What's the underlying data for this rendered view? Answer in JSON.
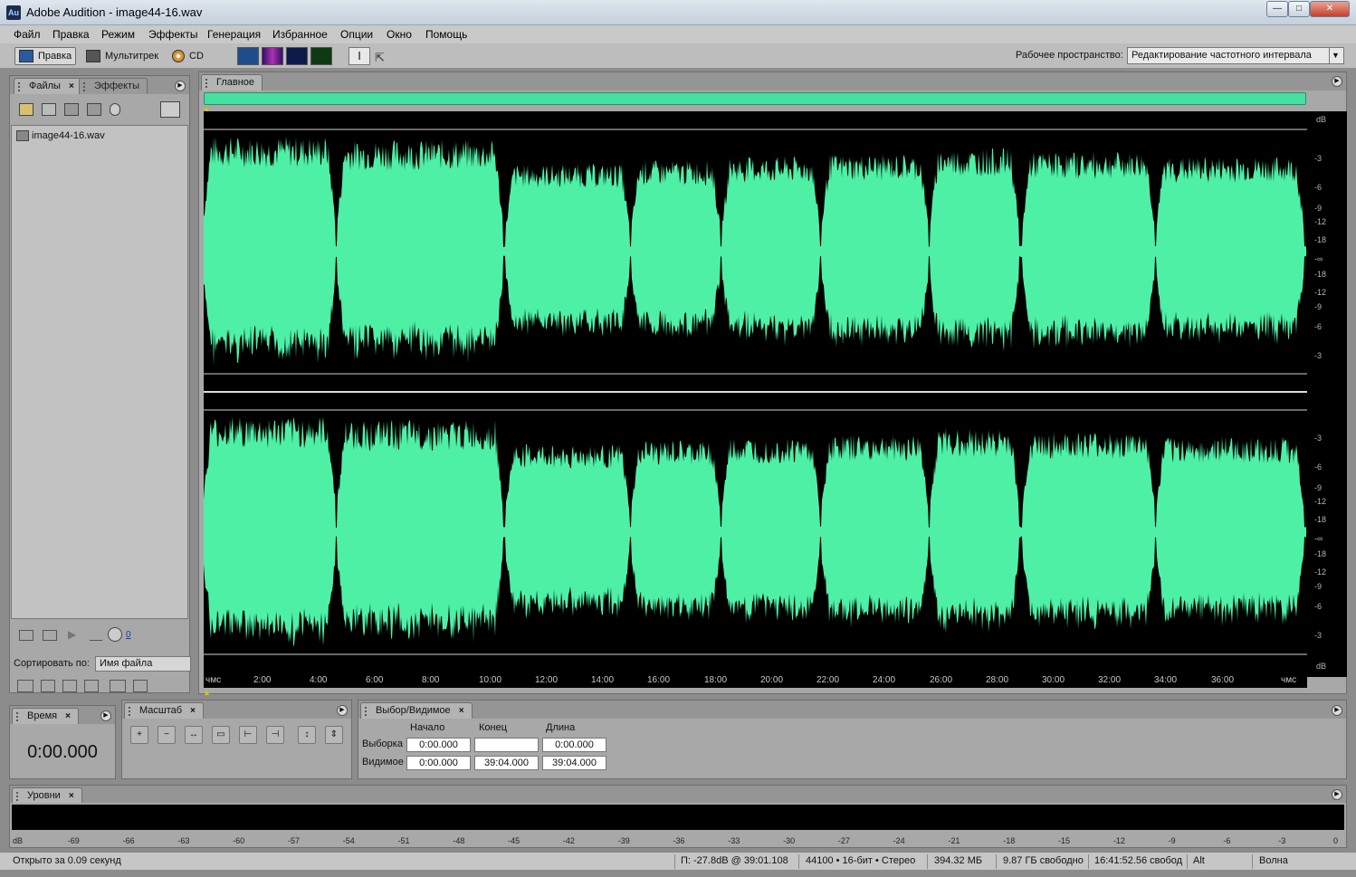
{
  "window": {
    "title": "Adobe Audition - image44-16.wav",
    "icon_text": "Au"
  },
  "menu": [
    "Файл",
    "Правка",
    "Режим",
    "Эффекты",
    "Генерация",
    "Избранное",
    "Опции",
    "Окно",
    "Помощь"
  ],
  "toolbar": {
    "edit_label": "Правка",
    "multitrack_label": "Мультитрек",
    "cd_label": "CD",
    "workspace_label": "Рабочее пространство:",
    "workspace_value": "Редактирование частотного интервала"
  },
  "files_panel": {
    "tabs": [
      "Файлы",
      "Эффекты"
    ],
    "file_name": "image44-16.wav",
    "sort_label": "Сортировать по:",
    "sort_value": "Имя файла",
    "volume_value": "0"
  },
  "main_panel": {
    "tab_title": "Главное",
    "db_unit": "dB",
    "db_ticks_top": [
      "-3",
      "-6",
      "-9",
      "-12",
      "-18",
      "-∞",
      "-18",
      "-12",
      "-9",
      "-6",
      "-3"
    ],
    "db_ticks_bottom": [
      "-3",
      "-6",
      "-9",
      "-12",
      "-18",
      "-∞",
      "-18",
      "-12",
      "-9",
      "-6",
      "-3"
    ],
    "time_ticks": [
      "чмс",
      "2:00",
      "4:00",
      "6:00",
      "8:00",
      "10:00",
      "12:00",
      "14:00",
      "16:00",
      "18:00",
      "20:00",
      "22:00",
      "24:00",
      "26:00",
      "28:00",
      "30:00",
      "32:00",
      "34:00",
      "36:00",
      "чмс"
    ],
    "waveform_color": "#4ef0a6"
  },
  "time_panel": {
    "tab": "Время",
    "value": "0:00.000"
  },
  "zoom_panel": {
    "tab": "Масштаб"
  },
  "selection_panel": {
    "tab": "Выбор/Видимое",
    "headers": [
      "Начало",
      "Конец",
      "Длина"
    ],
    "rows": [
      {
        "label": "Выборка",
        "start": "0:00.000",
        "end": "",
        "length": "0:00.000"
      },
      {
        "label": "Видимое",
        "start": "0:00.000",
        "end": "39:04.000",
        "length": "39:04.000"
      }
    ]
  },
  "levels_panel": {
    "tab": "Уровни",
    "scale": [
      "dB",
      "-69",
      "-66",
      "-63",
      "-60",
      "-57",
      "-54",
      "-51",
      "-48",
      "-45",
      "-42",
      "-39",
      "-36",
      "-33",
      "-30",
      "-27",
      "-24",
      "-21",
      "-18",
      "-15",
      "-12",
      "-9",
      "-6",
      "-3",
      "0"
    ]
  },
  "status": {
    "opened": "Открыто за 0.09 секунд",
    "cursor": "П: -27.8dB @  39:01.108",
    "format": "44100 • 16-бит • Стерео",
    "size": "394.32 МБ",
    "free_space": "9.87 ГБ свободно",
    "free_time": "16:41:52.56 свобод",
    "modifier": "Alt",
    "view": "Волна"
  }
}
